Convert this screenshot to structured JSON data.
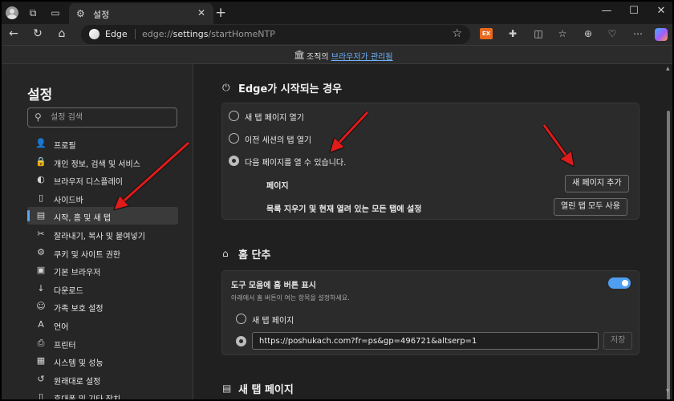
{
  "tab": {
    "title": "설정",
    "close_glyph": "✕"
  },
  "addressbar": {
    "site": "Edge",
    "url_prefix": "edge://",
    "url_bold": "settings",
    "url_suffix": "/startHomeNTP"
  },
  "extension_badge": "EX",
  "infobar": {
    "prefix": "조직의 ",
    "link": "브라우저가 관리됨"
  },
  "sidebar": {
    "title": "설정",
    "search_placeholder": "설정 검색",
    "items": [
      {
        "label": "프로필",
        "icon": "profile-icon"
      },
      {
        "label": "개인 정보, 검색 및 서비스",
        "icon": "lock-icon"
      },
      {
        "label": "브라우저 디스플레이",
        "icon": "palette-icon"
      },
      {
        "label": "사이드바",
        "icon": "sidebar-icon"
      },
      {
        "label": "시작, 홈 및 새 탭",
        "icon": "home-page-icon",
        "active": true
      },
      {
        "label": "잘라내기, 복사 및 붙여넣기",
        "icon": "clipboard-icon"
      },
      {
        "label": "쿠키 및 사이트 권한",
        "icon": "cookie-icon"
      },
      {
        "label": "기본 브라우저",
        "icon": "browser-icon"
      },
      {
        "label": "다운로드",
        "icon": "download-icon"
      },
      {
        "label": "가족 보호 설정",
        "icon": "family-icon"
      },
      {
        "label": "언어",
        "icon": "language-icon"
      },
      {
        "label": "프린터",
        "icon": "printer-icon"
      },
      {
        "label": "시스템 및 성능",
        "icon": "system-icon"
      },
      {
        "label": "원래대로 설정",
        "icon": "reset-icon"
      },
      {
        "label": "휴대폰 및 기타 장치",
        "icon": "phone-icon"
      }
    ]
  },
  "startup": {
    "title": "Edge가 시작되는 경우",
    "options": [
      "새 탭 페이지 열기",
      "이전 세션의 탭 열기",
      "다음 페이지를 열 수 있습니다."
    ],
    "selected_index": 2,
    "pages_label": "페이지",
    "add_page_button": "새 페이지 추가",
    "clear_label": "목록 지우기 및 현재 열려 있는 모든 탭에 설정",
    "use_open_tabs_button": "열린 탭 모두 사용"
  },
  "home": {
    "title": "홈 단추",
    "toggle_label": "도구 모음에 홈 버튼 표시",
    "toggle_on": true,
    "description": "아래에서 홈 버튼이 여는 항목을 설정하세요.",
    "option_new_tab": "새 탭 페이지",
    "url_value": "https://poshukach.com?fr=ps&gp=496721&altserp=1",
    "save_button": "저장"
  },
  "newtab": {
    "title": "새 탭 페이지"
  },
  "colors": {
    "accent": "#4f9ef0",
    "arrow": "#e01b1b"
  }
}
